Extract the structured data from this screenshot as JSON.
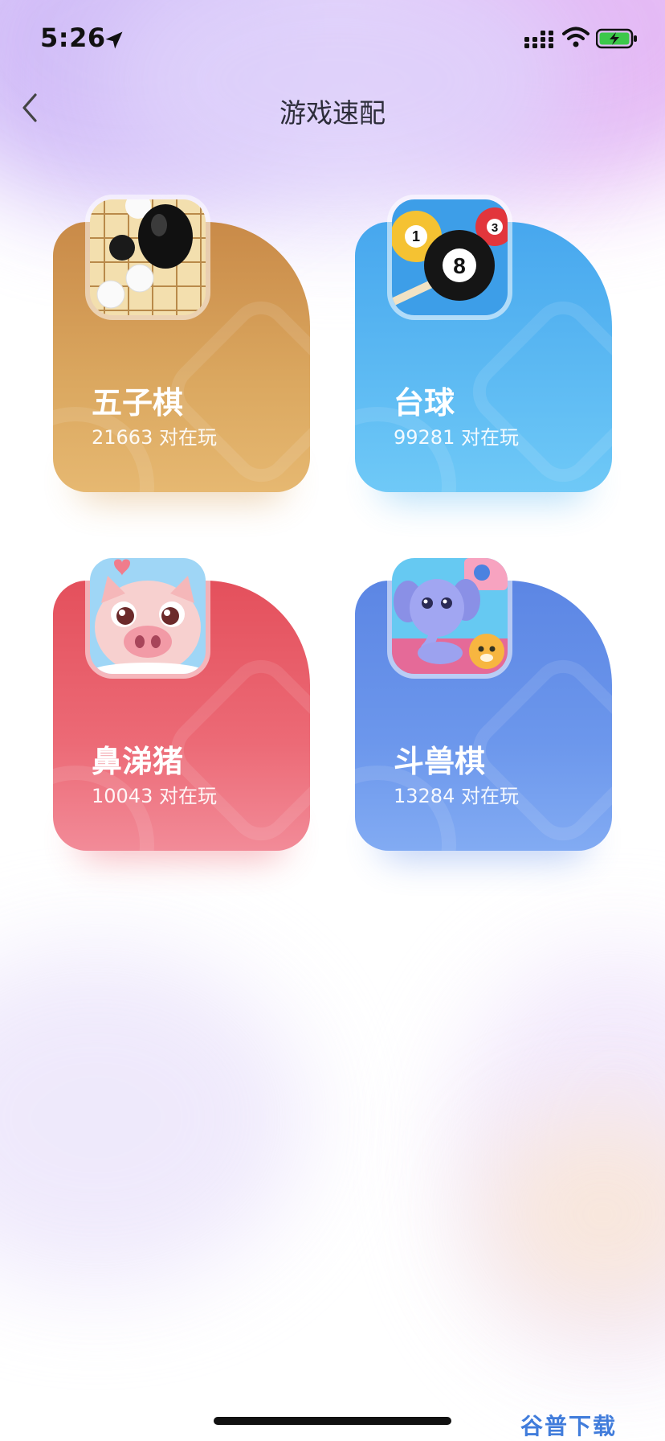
{
  "status_bar": {
    "time": "5:26"
  },
  "nav": {
    "title": "游戏速配"
  },
  "games": [
    {
      "title": "五子棋",
      "count": "21663 对在玩",
      "icon": "gomoku-icon"
    },
    {
      "title": "台球",
      "count": "99281 对在玩",
      "icon": "billiards-icon"
    },
    {
      "title": "鼻涕猪",
      "count": "10043 对在玩",
      "icon": "pig-icon"
    },
    {
      "title": "斗兽棋",
      "count": "13284 对在玩",
      "icon": "animal-chess-icon"
    }
  ],
  "watermark": "谷普下载"
}
